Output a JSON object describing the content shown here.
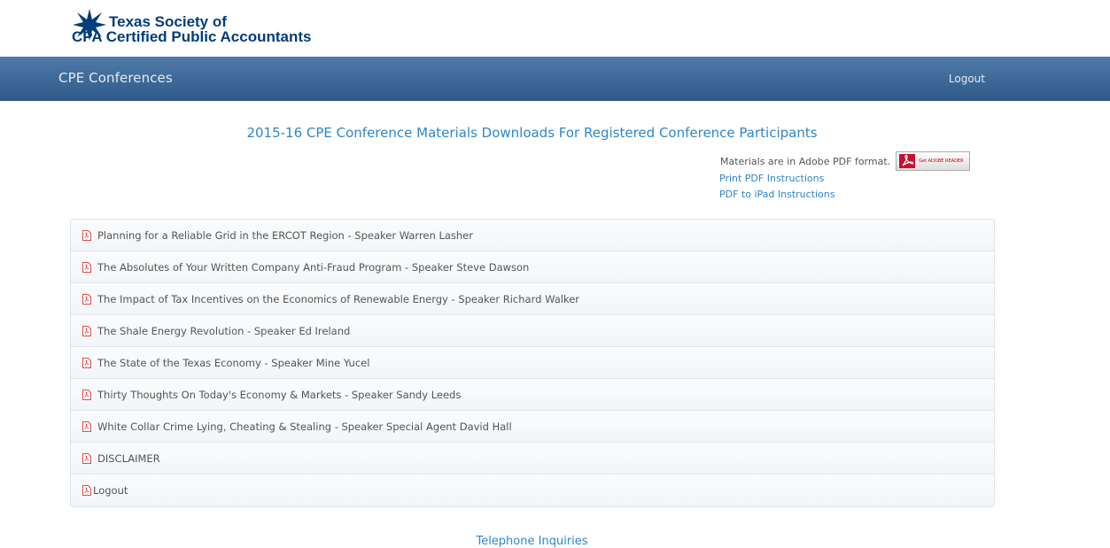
{
  "logo": {
    "line1": "Texas Society of",
    "line2": "CPA Certified Public Accountants"
  },
  "nav": {
    "brand": "CPE Conferences",
    "logout": "Logout"
  },
  "header": {
    "title": "2015-16 CPE Conference Materials Downloads For Registered Conference Participants",
    "pdf_note": "Materials are in Adobe PDF format.",
    "adobe_badge_text": "Get ADOBE READER",
    "link_print": "Print PDF Instructions",
    "link_ipad": "PDF to iPad Instructions"
  },
  "items": [
    "Planning for a Reliable Grid in the ERCOT Region - Speaker Warren Lasher",
    "The Absolutes of Your Written Company Anti-Fraud Program - Speaker Steve Dawson",
    "The Impact of Tax Incentives on the Economics of Renewable Energy - Speaker Richard Walker",
    "The Shale Energy Revolution - Speaker Ed Ireland",
    "The State of the Texas Economy - Speaker Mine Yucel",
    "Thirty Thoughts On Today's Economy & Markets - Speaker Sandy Leeds",
    "White Collar Crime Lying, Cheating & Stealing - Speaker Special Agent David Hall",
    "DISCLAIMER",
    "Logout"
  ],
  "footer_heading": "Telephone Inquiries",
  "colors": {
    "navbar": "#3b6796",
    "link": "#2f86c8",
    "pdf_icon": "#e04b4b",
    "logo": "#003d7c"
  }
}
